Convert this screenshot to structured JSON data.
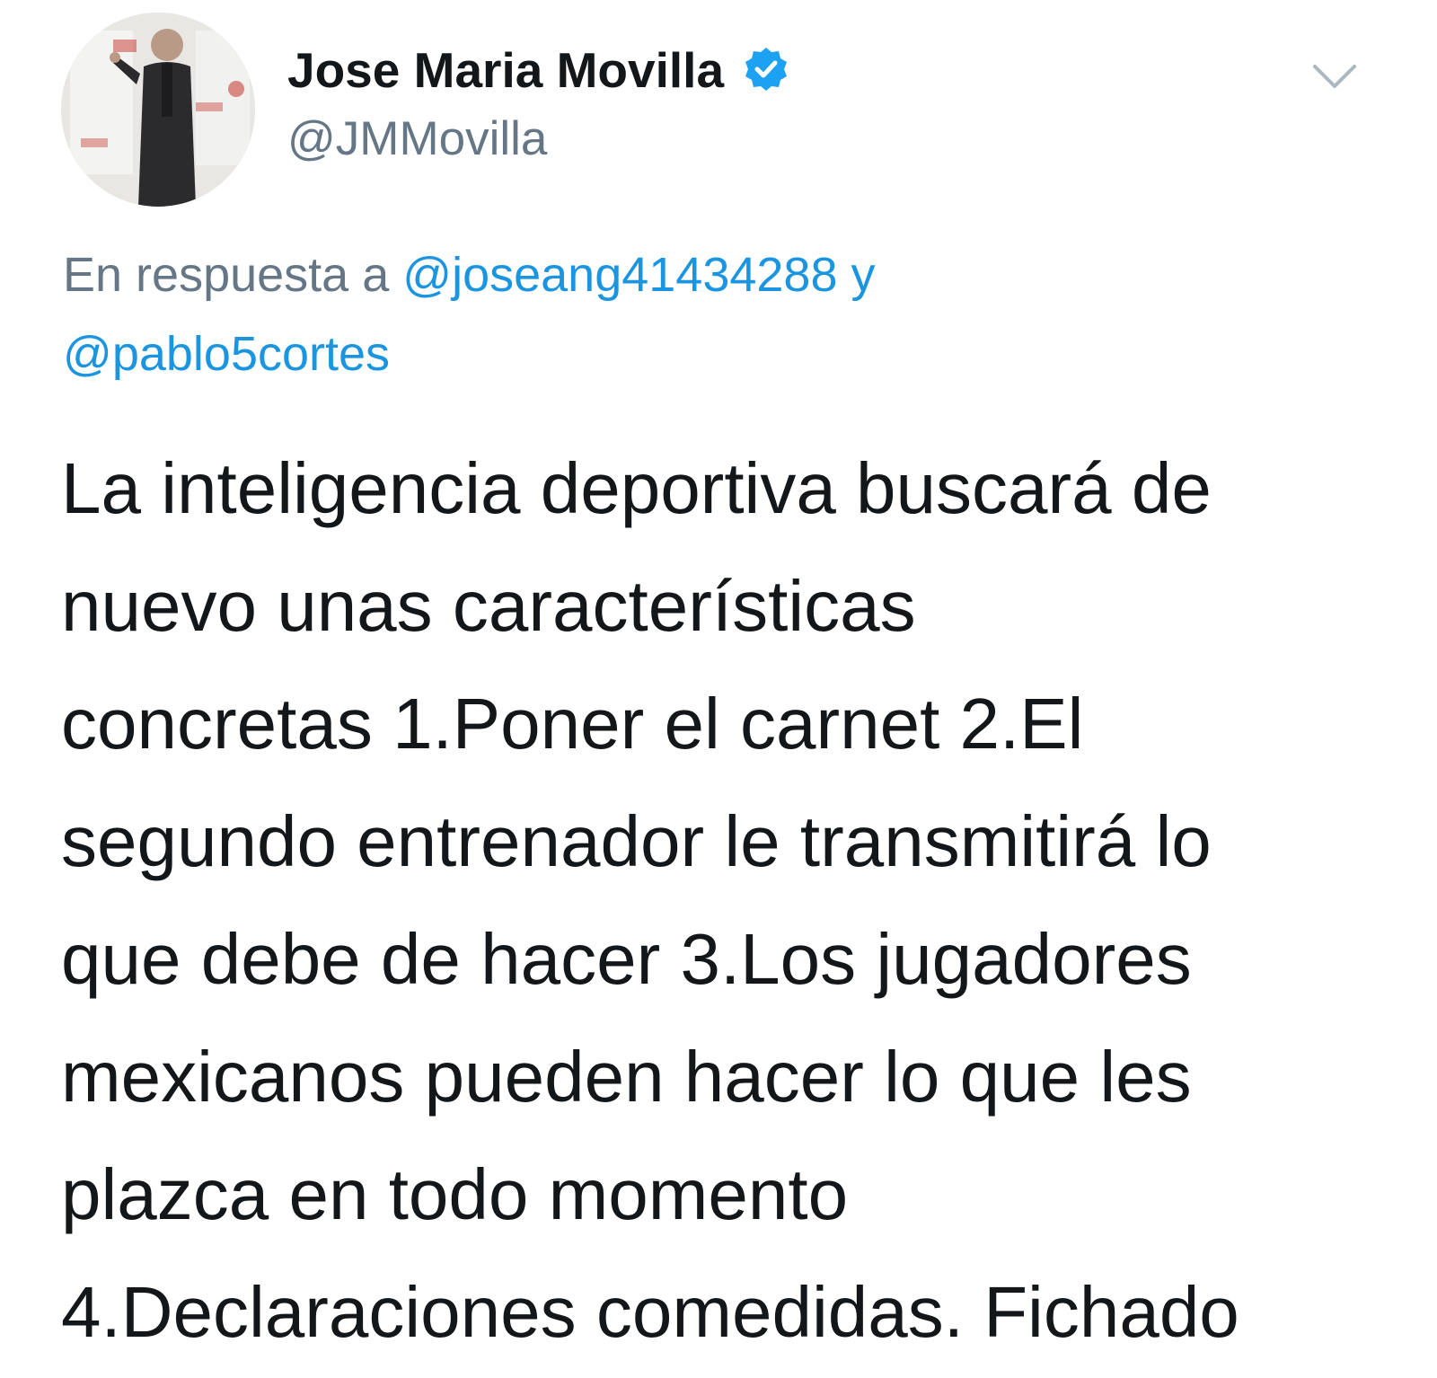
{
  "author": {
    "display_name": "Jose Maria Movilla",
    "handle": "@JMMovilla",
    "verified": true,
    "avatar_icon": "profile-photo"
  },
  "reply_context": {
    "prefix": "En respuesta a",
    "mention_1": "@joseang41434288",
    "conjunction": "y",
    "mention_2": "@pablo5cortes"
  },
  "tweet_lines": [
    "La inteligencia deportiva buscará de",
    "nuevo unas características",
    "concretas 1.Poner el carnet 2.El",
    "segundo entrenador le transmitirá lo",
    "que debe de hacer 3.Los jugadores",
    "mexicanos pueden hacer lo que les",
    "plazca en todo momento",
    "4.Declaraciones comedidas. Fichado"
  ],
  "colors": {
    "text": "#14171a",
    "secondary": "#657786",
    "link": "#1b95e0",
    "verified": "#1da1f2"
  },
  "icons": {
    "verified": "verified-badge-icon",
    "menu": "chevron-down-icon"
  }
}
